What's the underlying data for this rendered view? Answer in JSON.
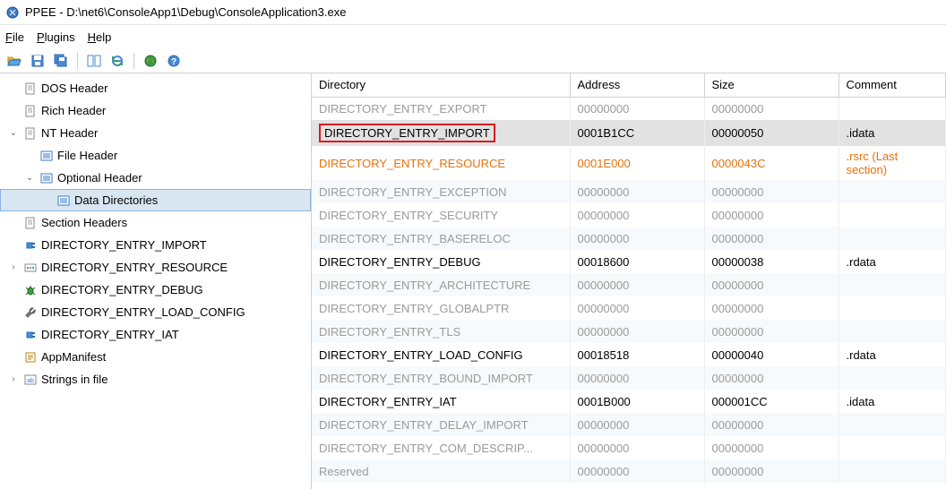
{
  "title": "PPEE - D:\\net6\\ConsoleApp1\\Debug\\ConsoleApplication3.exe",
  "menus": {
    "file": "File",
    "plugins": "Plugins",
    "help": "Help"
  },
  "tree": {
    "dos_header": "DOS Header",
    "rich_header": "Rich Header",
    "nt_header": "NT Header",
    "file_header": "File Header",
    "optional_header": "Optional Header",
    "data_directories": "Data Directories",
    "section_headers": "Section Headers",
    "entry_import": "DIRECTORY_ENTRY_IMPORT",
    "entry_resource": "DIRECTORY_ENTRY_RESOURCE",
    "entry_debug": "DIRECTORY_ENTRY_DEBUG",
    "entry_load_config": "DIRECTORY_ENTRY_LOAD_CONFIG",
    "entry_iat": "DIRECTORY_ENTRY_IAT",
    "app_manifest": "AppManifest",
    "strings_in_file": "Strings in file"
  },
  "table": {
    "headers": {
      "directory": "Directory",
      "address": "Address",
      "size": "Size",
      "comment": "Comment"
    },
    "rows": [
      {
        "dir": "DIRECTORY_ENTRY_EXPORT",
        "addr": "00000000",
        "size": "00000000",
        "comment": "",
        "cls": "gray"
      },
      {
        "dir": "DIRECTORY_ENTRY_IMPORT",
        "addr": "0001B1CC",
        "size": "00000050",
        "comment": ".idata",
        "cls": "selected"
      },
      {
        "dir": "DIRECTORY_ENTRY_RESOURCE",
        "addr": "0001E000",
        "size": "0000043C",
        "comment": ".rsrc (Last section)",
        "cls": "orange"
      },
      {
        "dir": "DIRECTORY_ENTRY_EXCEPTION",
        "addr": "00000000",
        "size": "00000000",
        "comment": "",
        "cls": "gray"
      },
      {
        "dir": "DIRECTORY_ENTRY_SECURITY",
        "addr": "00000000",
        "size": "00000000",
        "comment": "",
        "cls": "gray"
      },
      {
        "dir": "DIRECTORY_ENTRY_BASERELOC",
        "addr": "00000000",
        "size": "00000000",
        "comment": "",
        "cls": "gray"
      },
      {
        "dir": "DIRECTORY_ENTRY_DEBUG",
        "addr": "00018600",
        "size": "00000038",
        "comment": ".rdata",
        "cls": ""
      },
      {
        "dir": "DIRECTORY_ENTRY_ARCHITECTURE",
        "addr": "00000000",
        "size": "00000000",
        "comment": "",
        "cls": "gray"
      },
      {
        "dir": "DIRECTORY_ENTRY_GLOBALPTR",
        "addr": "00000000",
        "size": "00000000",
        "comment": "",
        "cls": "gray"
      },
      {
        "dir": "DIRECTORY_ENTRY_TLS",
        "addr": "00000000",
        "size": "00000000",
        "comment": "",
        "cls": "gray"
      },
      {
        "dir": "DIRECTORY_ENTRY_LOAD_CONFIG",
        "addr": "00018518",
        "size": "00000040",
        "comment": ".rdata",
        "cls": ""
      },
      {
        "dir": "DIRECTORY_ENTRY_BOUND_IMPORT",
        "addr": "00000000",
        "size": "00000000",
        "comment": "",
        "cls": "gray"
      },
      {
        "dir": "DIRECTORY_ENTRY_IAT",
        "addr": "0001B000",
        "size": "000001CC",
        "comment": ".idata",
        "cls": ""
      },
      {
        "dir": "DIRECTORY_ENTRY_DELAY_IMPORT",
        "addr": "00000000",
        "size": "00000000",
        "comment": "",
        "cls": "gray"
      },
      {
        "dir": "DIRECTORY_ENTRY_COM_DESCRIP...",
        "addr": "00000000",
        "size": "00000000",
        "comment": "",
        "cls": "gray"
      },
      {
        "dir": "Reserved",
        "addr": "00000000",
        "size": "00000000",
        "comment": "",
        "cls": "gray"
      }
    ]
  }
}
